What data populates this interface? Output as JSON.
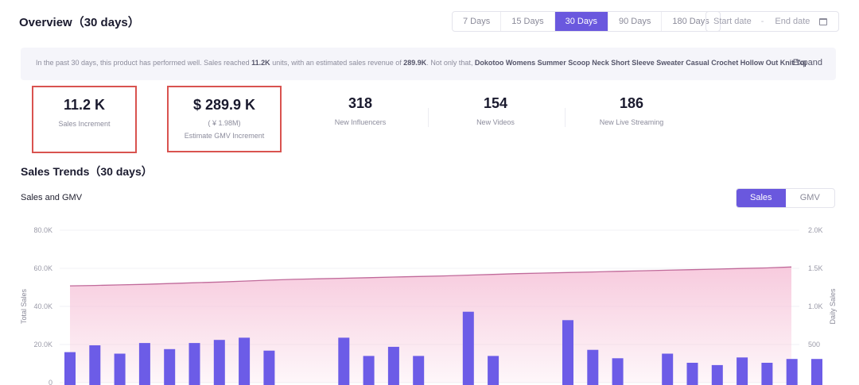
{
  "overview": {
    "title": "Overview（30 days）",
    "range_tabs": [
      "7 Days",
      "15 Days",
      "30 Days",
      "90 Days",
      "180 Days"
    ],
    "active_tab": "30 Days",
    "start_placeholder": "Start date",
    "separator": "-",
    "end_placeholder": "End date"
  },
  "summary": {
    "text_1": "In the past 30 days, this product has performed well. Sales reached ",
    "units": "11.2K",
    "text_2": " units, with an estimated sales revenue of ",
    "revenue": "289.9K",
    "text_3": ". Not only that, ",
    "product": "Dokotoo Womens Summer Scoop Neck Short Sleeve Sweater Casual Crochet Hollow Out Knit Tops Pu",
    "expand_label": "Expand"
  },
  "stats": [
    {
      "value": "11.2 K",
      "label": "Sales Increment"
    },
    {
      "value": "$ 289.9 K",
      "sub": "( ¥ 1.98M)",
      "label": "Estimate GMV Increment"
    },
    {
      "value": "318",
      "label": "New Influencers"
    },
    {
      "value": "154",
      "label": "New Videos"
    },
    {
      "value": "186",
      "label": "New Live Streaming"
    }
  ],
  "trends": {
    "title": "Sales Trends（30 days）",
    "chart_title": "Sales and GMV",
    "toggle": [
      "Sales",
      "GMV"
    ],
    "active_toggle": "Sales"
  },
  "chart_data": {
    "type": "bar",
    "ylabel": "Total Sales",
    "y2label": "Daily Sales",
    "ylim": [
      0,
      80000
    ],
    "y2lim": [
      0,
      2000
    ],
    "yticks": [
      "0",
      "20.0K",
      "40.0K",
      "60.0K",
      "80.0K"
    ],
    "y2ticks": [
      "500",
      "1.0K",
      "1.5K",
      "2.0K"
    ],
    "series": [
      {
        "name": "Total Sales",
        "type": "area",
        "values": [
          50800,
          51000,
          51300,
          51600,
          52000,
          52400,
          52800,
          53300,
          53800,
          54200,
          54500,
          54800,
          55100,
          55400,
          55700,
          56000,
          56400,
          56800,
          57200,
          57500,
          57800,
          58100,
          58400,
          58700,
          59000,
          59300,
          59600,
          59900,
          60200,
          60700
        ]
      },
      {
        "name": "Daily Sales",
        "type": "bar",
        "values": [
          400,
          490,
          380,
          520,
          440,
          520,
          560,
          590,
          420,
          0,
          0,
          590,
          350,
          470,
          350,
          0,
          930,
          350,
          0,
          0,
          820,
          430,
          320,
          0,
          380,
          260,
          230,
          330,
          260,
          310,
          310
        ]
      }
    ],
    "grid": true,
    "area_color": "#f7c8dc",
    "line_color": "#c06a9a",
    "bar_color": "#6c5ce7"
  }
}
